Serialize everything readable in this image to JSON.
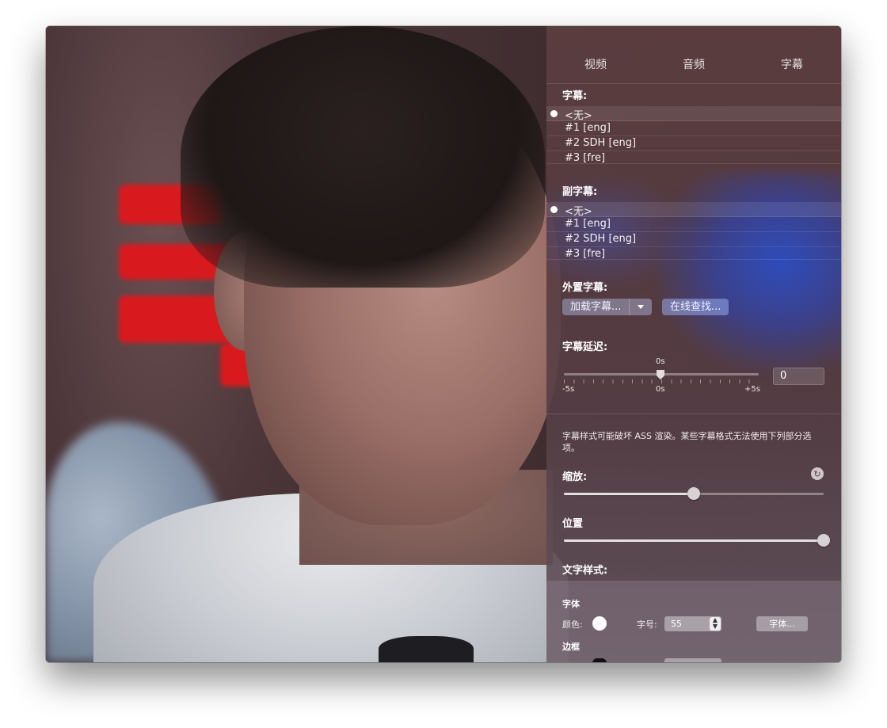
{
  "tabs": {
    "video": "视频",
    "audio": "音频",
    "subtitles": "字幕"
  },
  "primary_subtitles": {
    "heading": "字幕:",
    "items": [
      {
        "label": "<无>",
        "selected": true
      },
      {
        "label": "#1 [eng]",
        "selected": false
      },
      {
        "label": "#2 SDH [eng]",
        "selected": false
      },
      {
        "label": "#3 [fre]",
        "selected": false
      }
    ]
  },
  "secondary_subtitles": {
    "heading": "副字幕:",
    "items": [
      {
        "label": "<无>",
        "selected": true
      },
      {
        "label": "#1 [eng]",
        "selected": false
      },
      {
        "label": "#2 SDH [eng]",
        "selected": false
      },
      {
        "label": "#3 [fre]",
        "selected": false
      }
    ]
  },
  "external": {
    "heading": "外置字幕:",
    "load_label": "加载字幕...",
    "online_label": "在线查找..."
  },
  "delay": {
    "heading": "字幕延迟:",
    "current_label": "0s",
    "min_label": "-5s",
    "mid_label": "0s",
    "max_label": "+5s",
    "value": "0",
    "slider_fraction": 0.5
  },
  "style_warning": "字幕样式可能破坏 ASS 渲染。某些字幕格式无法使用下列部分选项。",
  "scale": {
    "heading": "缩放:",
    "fraction": 0.5
  },
  "position": {
    "heading": "位置",
    "fraction": 1.0
  },
  "text_style": {
    "heading": "文字样式:",
    "font_group": "字体",
    "color_label": "颜色:",
    "color": "#ffffff",
    "size_label": "字号:",
    "size_value": "55",
    "font_button": "字体...",
    "border_group": "边框"
  },
  "colors": {
    "sign_red": "#d81a1f",
    "selection_highlight": "#4a6ad8"
  }
}
